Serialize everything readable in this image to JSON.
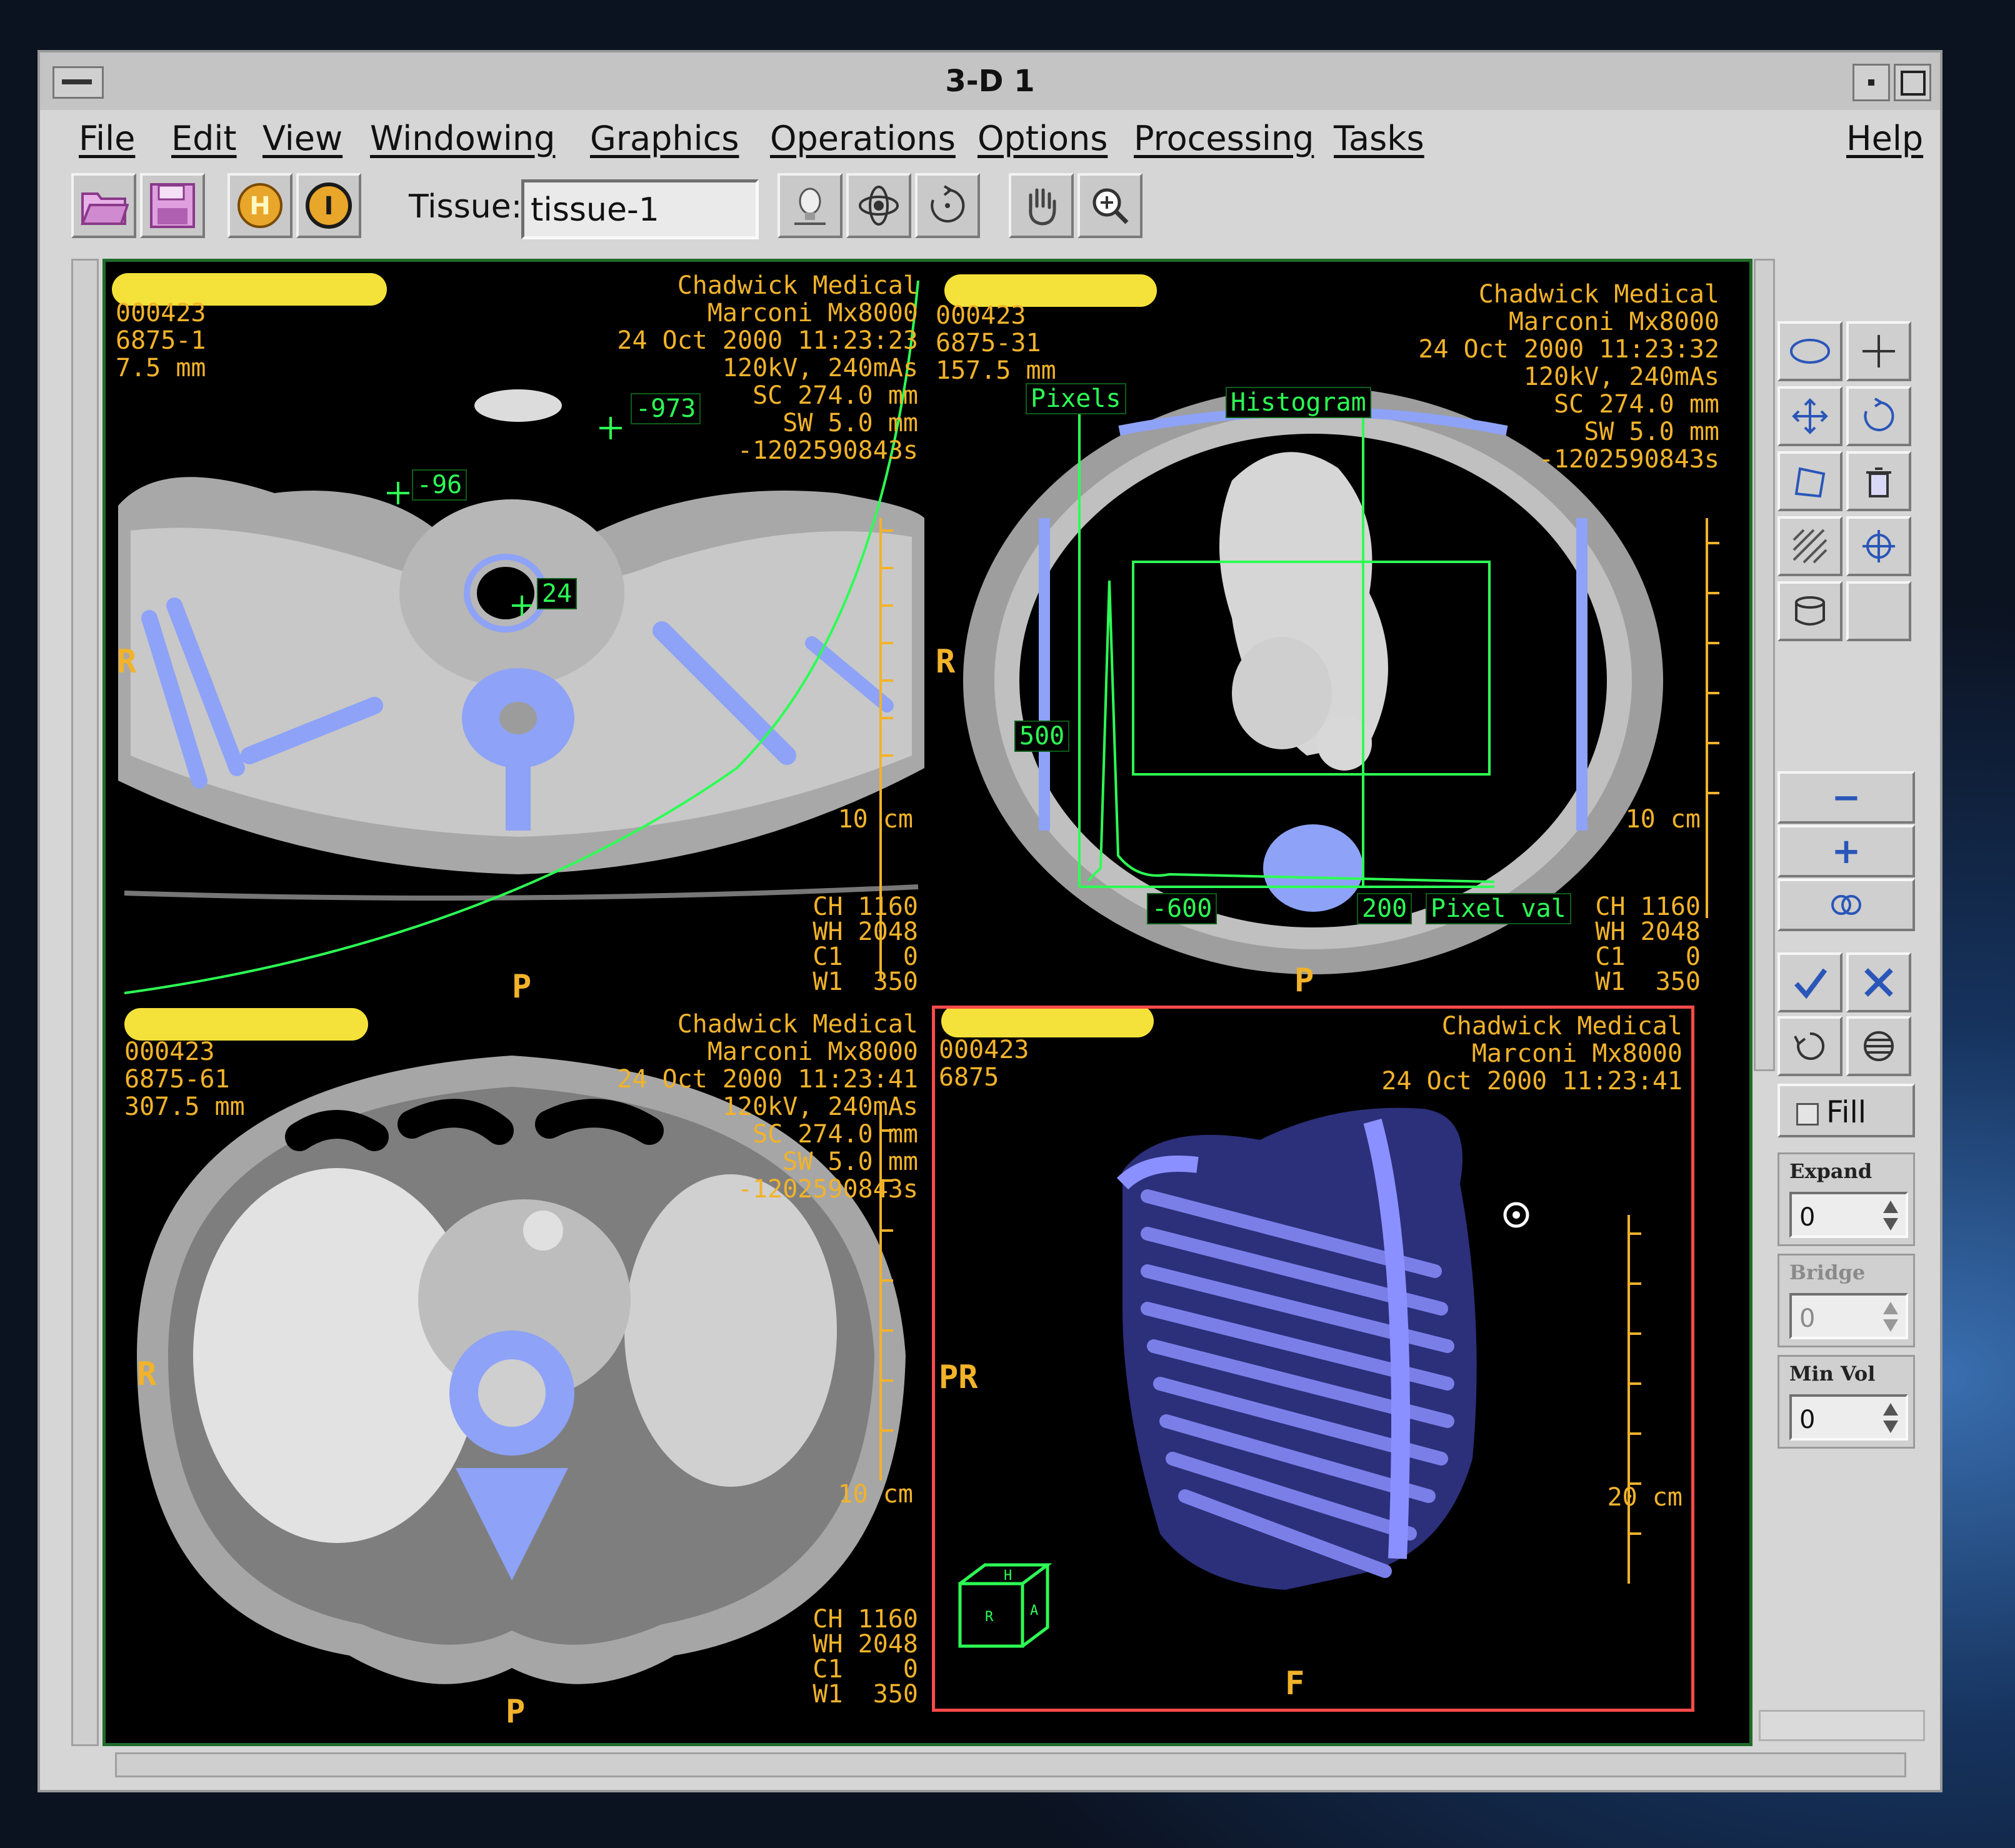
{
  "window": {
    "title": "3-D 1"
  },
  "menu": {
    "file": "File",
    "edit": "Edit",
    "view": "View",
    "windowing": "Windowing",
    "graphics": "Graphics",
    "operations": "Operations",
    "options": "Options",
    "processing": "Processing",
    "tasks": "Tasks",
    "help": "Help"
  },
  "toolbar": {
    "h_label": "H",
    "i_label": "I",
    "tissue_label": "Tissue:",
    "tissue_value": "tissue-1"
  },
  "viewports": {
    "tl": {
      "id": "000423",
      "series": "6875-1",
      "position": "7.5 mm",
      "site": "Chadwick Medical",
      "scanner": "Marconi Mx8000",
      "datetime": "24 Oct 2000 11:23:23",
      "kv": "120kV, 240mAs",
      "sc": "SC 274.0 mm",
      "sw": "SW 5.0 mm",
      "code": "-1202590843s",
      "window": [
        "CH 1160",
        "WH 2048",
        "C1    0",
        "W1  350"
      ],
      "orient_left": "R",
      "orient_bottom": "P",
      "scale": "10 cm",
      "hu_marks": [
        "-973",
        "-96",
        "24"
      ]
    },
    "tr": {
      "id": "000423",
      "series": "6875-31",
      "position": "157.5 mm",
      "site": "Chadwick Medical",
      "scanner": "Marconi Mx8000",
      "datetime": "24 Oct 2000 11:23:32",
      "kv": "120kV, 240mAs",
      "sc": "SC 274.0 mm",
      "sw": "SW 5.0 mm",
      "code": "-1202590843s",
      "window": [
        "CH 1160",
        "WH 2048",
        "C1    0",
        "W1  350"
      ],
      "orient_left": "R",
      "orient_bottom": "P",
      "scale": "10 cm",
      "histogram": {
        "title": "Histogram",
        "y_label": "Pixels",
        "y_tick": "500",
        "x_min": "-600",
        "x_max": "200",
        "x_label": "Pixel val"
      }
    },
    "bl": {
      "id": "000423",
      "series": "6875-61",
      "position": "307.5 mm",
      "site": "Chadwick Medical",
      "scanner": "Marconi Mx8000",
      "datetime": "24 Oct 2000 11:23:41",
      "kv": "120kV, 240mAs",
      "sc": "SC 274.0 mm",
      "sw": "SW 5.0 mm",
      "code": "-1202590843s",
      "window": [
        "CH 1160",
        "WH 2048",
        "C1    0",
        "W1  350"
      ],
      "orient_left": "R",
      "orient_bottom": "P",
      "scale": "10 cm"
    },
    "br": {
      "id": "000423",
      "series": "6875",
      "site": "Chadwick Medical",
      "scanner": "Marconi Mx8000",
      "datetime": "24 Oct 2000 11:23:41",
      "orient_left": "PR",
      "orient_bottom": "F",
      "scale": "20 cm",
      "cube": {
        "top": "H",
        "left": "R",
        "right": "A"
      }
    }
  },
  "panel": {
    "fill_label": "Fill",
    "expand": {
      "label": "Expand",
      "value": "0"
    },
    "bridge": {
      "label": "Bridge",
      "value": "0"
    },
    "min_vol": {
      "label": "Min Vol",
      "value": "0"
    },
    "minus": "−",
    "plus": "+"
  },
  "colors": {
    "overlay_text": "#f2b32a",
    "graphics_green": "#2dff55",
    "bone_highlight": "#8ea2f7",
    "active_border": "#ff4a4a",
    "rendering_blue": "#6b73e8"
  }
}
